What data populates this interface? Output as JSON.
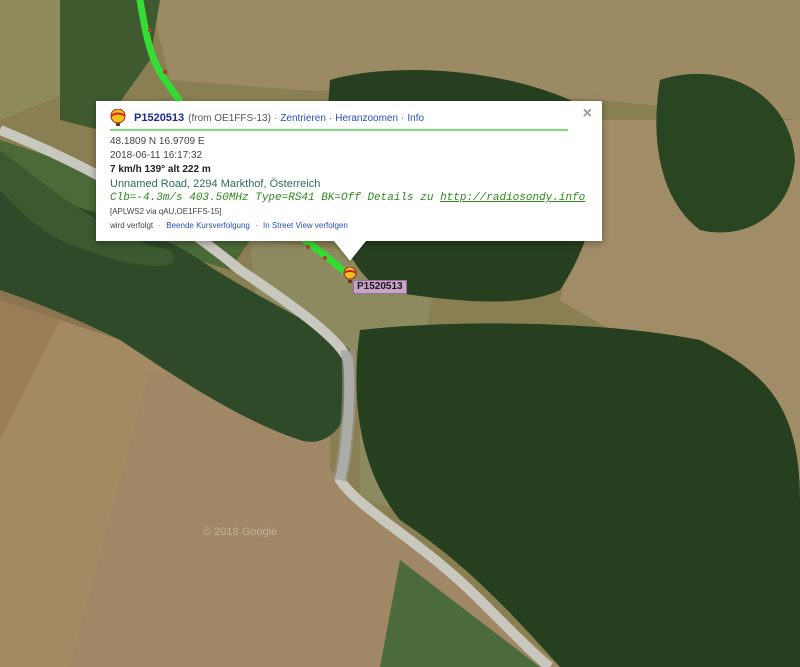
{
  "popup": {
    "callsign": "P1520513",
    "from": "(from OE1FFS-13)",
    "actions": [
      "Zentrieren",
      "Heranzoomen",
      "Info"
    ],
    "separator": "·",
    "close_symbol": "×",
    "coords": "48.1809 N 16.9709 E",
    "timestamp": "2018-06-11 16:17:32",
    "speed_alt": "7 km/h 139° alt 222 m",
    "address": "Unnamed Road, 2294 Markthof, Österreich",
    "comment": "Clb=-4.3m/s 403.50MHz Type=RS41 BK=Off Details zu ",
    "comment_link": "http://radiosondy.info",
    "path": "[APLWS2 via qAU,OE1FFS-15]",
    "tracking_text": "wird verfolgt",
    "tracking_links": [
      "Beende Kursverfolgung",
      "In Street View verfolgen"
    ]
  },
  "marker": {
    "label": "P1520513",
    "icon": "balloon-icon"
  },
  "map": {
    "watermark": "© 2018 Google",
    "track_color": "#33dd33"
  },
  "colors": {
    "accent_link": "#2a4fc1",
    "label_bg": "#c8a4c8"
  }
}
